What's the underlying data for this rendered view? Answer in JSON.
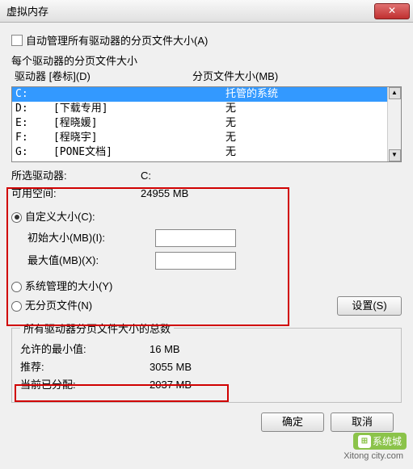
{
  "title": "虚拟内存",
  "auto_manage_label": "自动管理所有驱动器的分页文件大小(A)",
  "per_drive_label": "每个驱动器的分页文件大小",
  "columns": {
    "drive": "驱动器 [卷标](D)",
    "size": "分页文件大小(MB)"
  },
  "drives": [
    {
      "letter": "C:",
      "label": "",
      "size": "托管的系统",
      "selected": true
    },
    {
      "letter": "D:",
      "label": "[下载专用]",
      "size": "无",
      "selected": false
    },
    {
      "letter": "E:",
      "label": "[程晓媛]",
      "size": "无",
      "selected": false
    },
    {
      "letter": "F:",
      "label": "[程晓宇]",
      "size": "无",
      "selected": false
    },
    {
      "letter": "G:",
      "label": "[PONE文档]",
      "size": "无",
      "selected": false
    }
  ],
  "selected_drive": {
    "label": "所选驱动器:",
    "value": "C:"
  },
  "avail_space": {
    "label": "可用空间:",
    "value": "24955 MB"
  },
  "custom_size": {
    "radio": "自定义大小(C):",
    "initial_label": "初始大小(MB)(I):",
    "initial_value": "",
    "max_label": "最大值(MB)(X):",
    "max_value": ""
  },
  "system_managed": "系统管理的大小(Y)",
  "no_paging": "无分页文件(N)",
  "set_btn": "设置(S)",
  "totals": {
    "legend": "所有驱动器分页文件大小的总数",
    "min": {
      "label": "允许的最小值:",
      "value": "16 MB"
    },
    "rec": {
      "label": "推荐:",
      "value": "3055 MB"
    },
    "cur": {
      "label": "当前已分配:",
      "value": "2037 MB"
    }
  },
  "ok": "确定",
  "cancel": "取消",
  "watermark": {
    "brand": "系统城",
    "url": "Xitong city.com"
  }
}
